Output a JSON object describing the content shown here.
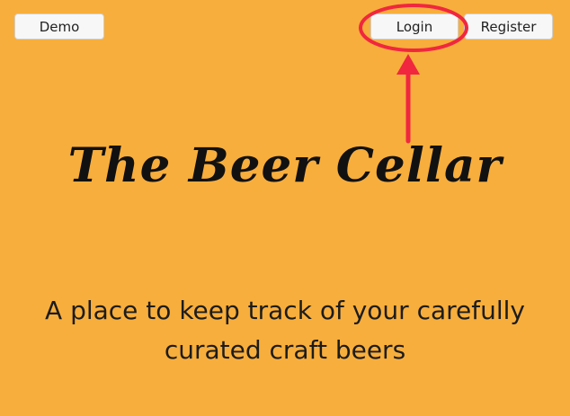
{
  "nav": {
    "demo_label": "Demo",
    "login_label": "Login",
    "register_label": "Register"
  },
  "hero": {
    "title": "The Beer Cellar",
    "tagline": "A place to keep track of your carefully curated craft beers"
  },
  "annotation": {
    "target": "login-button",
    "color": "#f0273f"
  },
  "colors": {
    "background": "#f8ae3c",
    "button_bg": "#f7f7f7",
    "text": "#111111"
  }
}
